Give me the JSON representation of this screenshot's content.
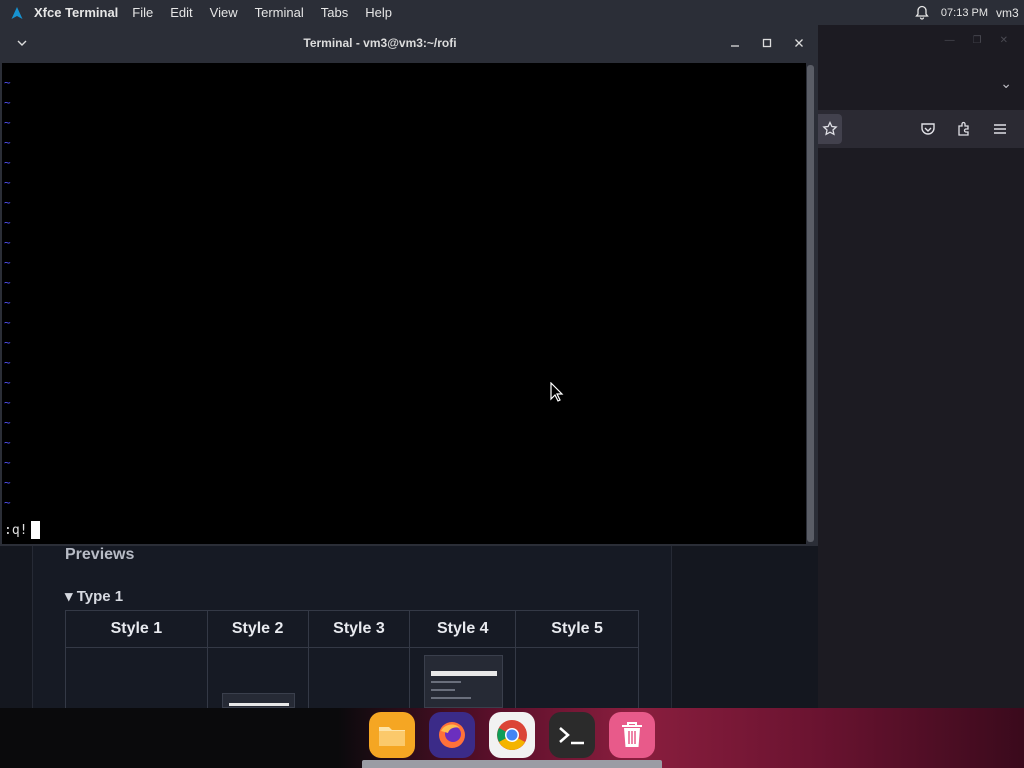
{
  "top_panel": {
    "app_name": "Xfce Terminal",
    "menu": [
      "File",
      "Edit",
      "View",
      "Terminal",
      "Tabs",
      "Help"
    ],
    "clock": "07:13 PM",
    "user": "vm3"
  },
  "terminal": {
    "title": "Terminal - vm3@vm3:~/rofi",
    "tilde": "~",
    "command": ":q!"
  },
  "page": {
    "previews_heading": "Previews",
    "type_heading": "▾ Type 1",
    "style_headers": [
      "Style 1",
      "Style 2",
      "Style 3",
      "Style 4",
      "Style 5"
    ]
  },
  "icons": {
    "panel_logo": "arch-logo-icon",
    "notifications": "bell-icon",
    "dock": [
      "files-icon",
      "firefox-icon",
      "chrome-icon",
      "terminal-icon",
      "trash-icon"
    ]
  },
  "colors": {
    "panel_bg": "#2b2e37",
    "terminal_bg": "#000000",
    "tilde": "#5555ff",
    "page_bg": "#14171f"
  }
}
